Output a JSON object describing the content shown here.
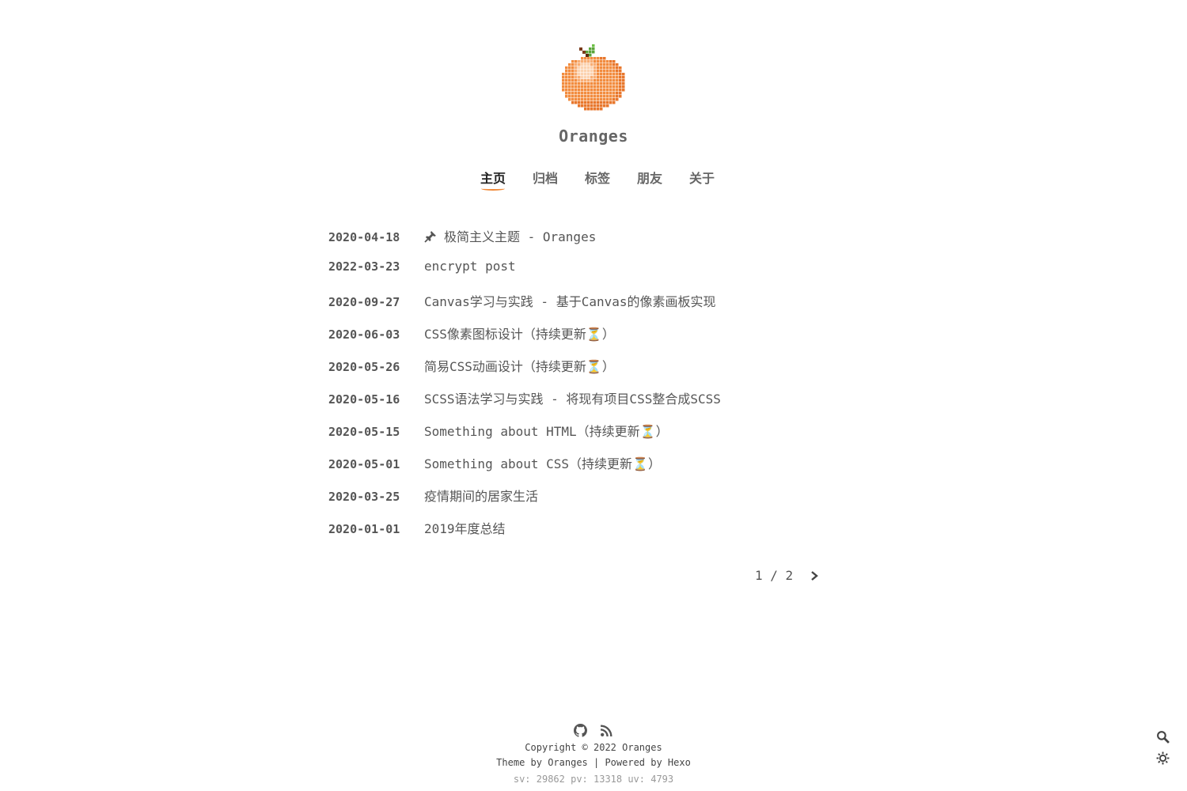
{
  "site": {
    "title": "Oranges",
    "logo_icon": "pixel-orange-icon",
    "accent_color": "#f08a3a"
  },
  "nav": {
    "items": [
      {
        "label": "主页",
        "active": true
      },
      {
        "label": "归档",
        "active": false
      },
      {
        "label": "标签",
        "active": false
      },
      {
        "label": "朋友",
        "active": false
      },
      {
        "label": "关于",
        "active": false
      }
    ]
  },
  "posts": [
    {
      "date": "2020-04-18",
      "title": "极简主义主题 - Oranges",
      "pinned": true
    },
    {
      "date": "2022-03-23",
      "title": "encrypt post",
      "pinned": false
    },
    {
      "date": "2020-09-27",
      "title": "Canvas学习与实践 - 基于Canvas的像素画板实现",
      "pinned": false
    },
    {
      "date": "2020-06-03",
      "title": "CSS像素图标设计（持续更新⏳）",
      "pinned": false
    },
    {
      "date": "2020-05-26",
      "title": "简易CSS动画设计（持续更新⏳）",
      "pinned": false
    },
    {
      "date": "2020-05-16",
      "title": "SCSS语法学习与实践 - 将现有项目CSS整合成SCSS",
      "pinned": false
    },
    {
      "date": "2020-05-15",
      "title": "Something about HTML（持续更新⏳）",
      "pinned": false
    },
    {
      "date": "2020-05-01",
      "title": "Something about CSS（持续更新⏳）",
      "pinned": false
    },
    {
      "date": "2020-03-25",
      "title": "疫情期间的居家生活",
      "pinned": false
    },
    {
      "date": "2020-01-01",
      "title": "2019年度总结",
      "pinned": false
    }
  ],
  "pagination": {
    "text": "1 / 2",
    "current": 1,
    "total": 2,
    "next_icon": "chevron-right-icon"
  },
  "footer": {
    "icons": [
      "github-icon",
      "rss-icon"
    ],
    "copyright": "Copyright © 2022 Oranges",
    "theme_line": "Theme by Oranges | Powered by Hexo",
    "stats": "sv: 29862 pv: 13318 uv: 4793"
  },
  "floating": {
    "search_icon": "search-icon",
    "theme_icon": "sun-icon"
  }
}
